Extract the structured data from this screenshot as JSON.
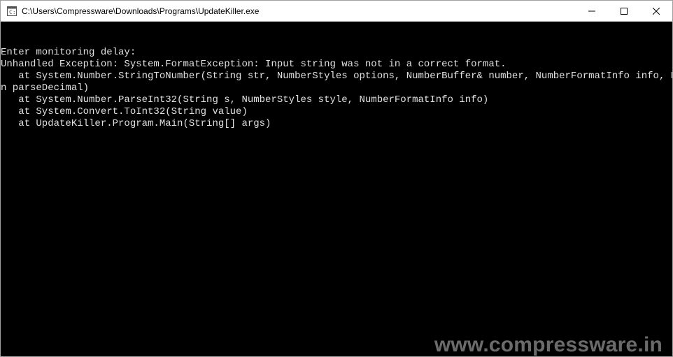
{
  "window": {
    "title": "C:\\Users\\Compressware\\Downloads\\Programs\\UpdateKiller.exe"
  },
  "console": {
    "lines": [
      "Enter monitoring delay:",
      "",
      "Unhandled Exception: System.FormatException: Input string was not in a correct format.",
      "   at System.Number.StringToNumber(String str, NumberStyles options, NumberBuffer& number, NumberFormatInfo info, Boolea",
      "n parseDecimal)",
      "   at System.Number.ParseInt32(String s, NumberStyles style, NumberFormatInfo info)",
      "   at System.Convert.ToInt32(String value)",
      "   at UpdateKiller.Program.Main(String[] args)"
    ]
  },
  "watermark": {
    "text": "www.compressware.in"
  },
  "colors": {
    "console_bg": "#000000",
    "console_fg": "#e0e0e0",
    "titlebar_bg": "#ffffff",
    "titlebar_fg": "#000000"
  }
}
